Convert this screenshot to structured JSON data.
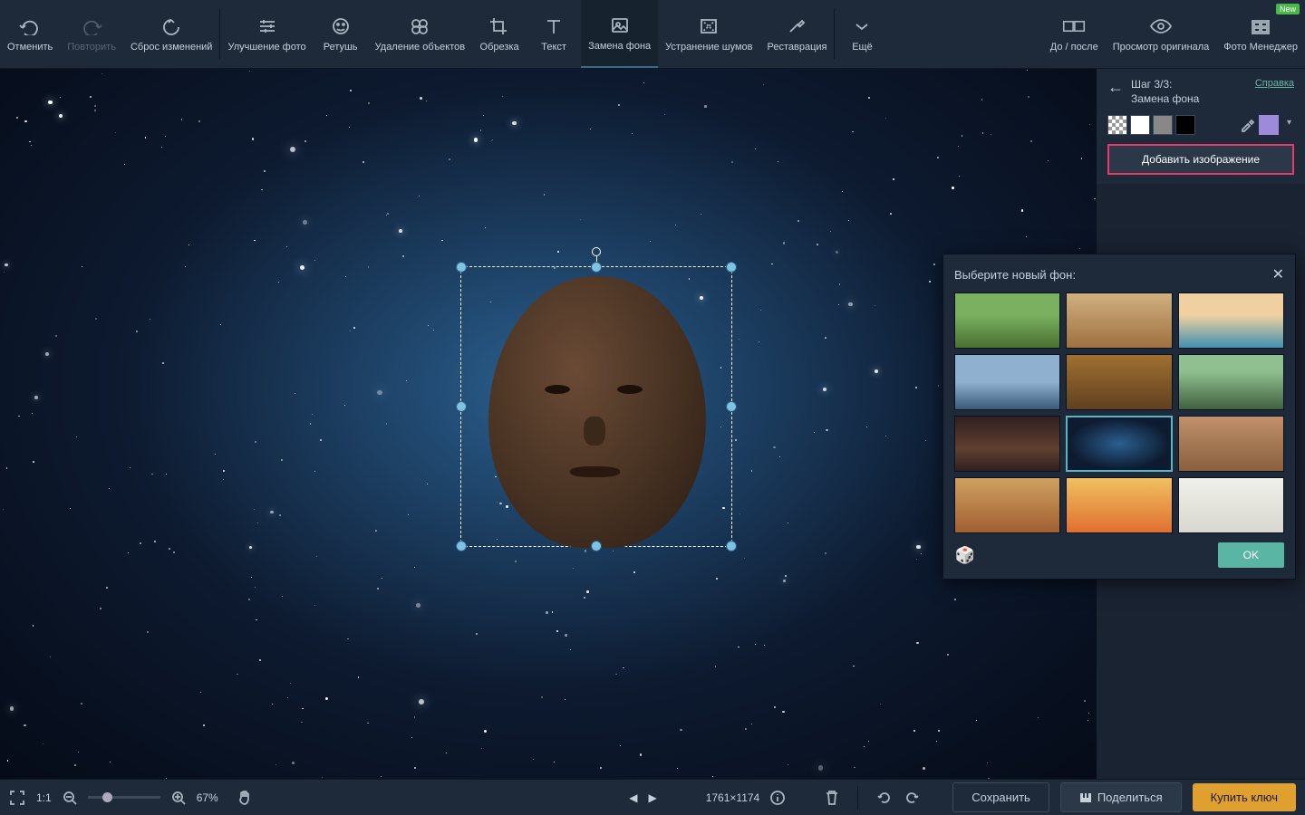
{
  "toolbar": {
    "undo": "Отменить",
    "redo": "Повторить",
    "reset": "Сброс изменений",
    "enhance": "Улучшение фото",
    "retouch": "Ретушь",
    "remove_obj": "Удаление объектов",
    "crop": "Обрезка",
    "text": "Текст",
    "bg_replace": "Замена фона",
    "denoise": "Устранение шумов",
    "restore": "Реставрация",
    "more": "Ещё",
    "before_after": "До / после",
    "view_original": "Просмотр оригинала",
    "photo_manager": "Фото Менеджер",
    "new_badge": "New"
  },
  "rpanel": {
    "step": "Шаг 3/3:",
    "title": "Замена фона",
    "help": "Справка",
    "add_image": "Добавить изображение"
  },
  "bg_popup": {
    "title": "Выберите новый фон:",
    "ok": "OK"
  },
  "bottom": {
    "ratio": "1:1",
    "zoom": "67%",
    "dim": "1761×1174",
    "save": "Сохранить",
    "share": "Поделиться",
    "buy": "Купить ключ"
  },
  "thumbs": [
    {
      "g": "linear-gradient(#7ab060 40%,#4a7030)"
    },
    {
      "g": "linear-gradient(#d0b080,#a07040)"
    },
    {
      "g": "linear-gradient(#f0d0a0 40%,#4090b0)"
    },
    {
      "g": "linear-gradient(#90b0d0 50%,#3a5a7a)"
    },
    {
      "g": "linear-gradient(#a07030,#604020)"
    },
    {
      "g": "linear-gradient(#90c090 30%,#406040)"
    },
    {
      "g": "linear-gradient(#302020,#604030 60%,#302020)"
    },
    {
      "g": "radial-gradient(ellipse,#2a5f8f,#0d1a2f 70%)",
      "sel": true
    },
    {
      "g": "linear-gradient(#c0906a,#8a6040)"
    },
    {
      "g": "linear-gradient(#d0a060,#a06030)"
    },
    {
      "g": "linear-gradient(#f0c060,#e07030)"
    },
    {
      "g": "linear-gradient(#f0f0ea,#d8d8d0)"
    }
  ]
}
